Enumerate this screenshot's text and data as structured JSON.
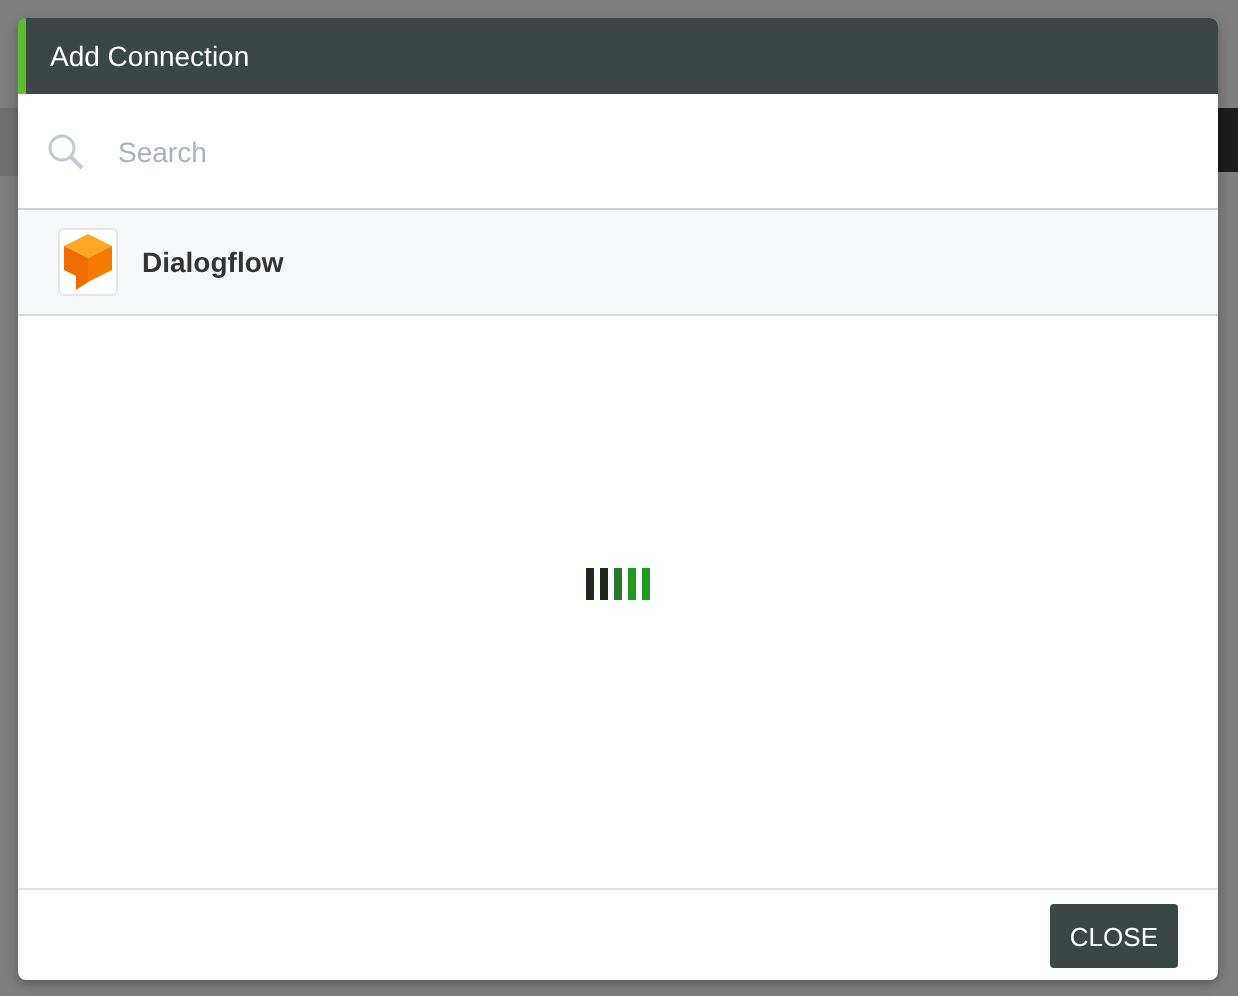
{
  "dialog": {
    "title": "Add Connection",
    "search": {
      "placeholder": "Search"
    },
    "connections": [
      {
        "name": "Dialogflow"
      }
    ],
    "loading": true,
    "buttons": [
      {
        "label": "CLOSE"
      }
    ]
  }
}
